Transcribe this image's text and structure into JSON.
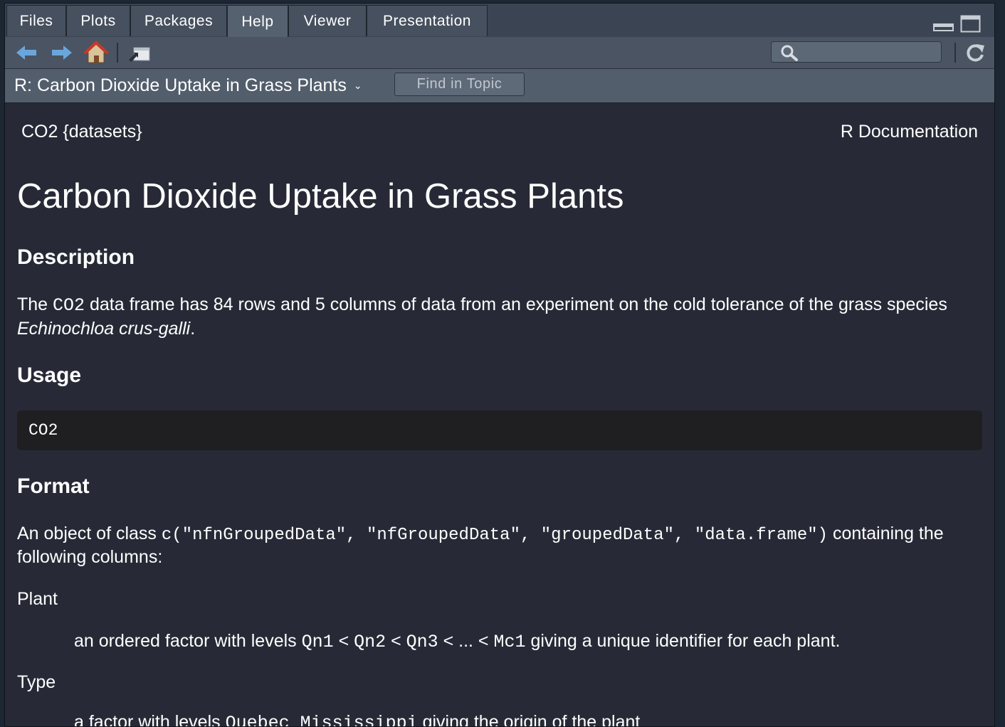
{
  "tabs": [
    {
      "label": "Files"
    },
    {
      "label": "Plots"
    },
    {
      "label": "Packages"
    },
    {
      "label": "Help"
    },
    {
      "label": "Viewer"
    },
    {
      "label": "Presentation"
    }
  ],
  "active_tab": "Help",
  "toolbar": {
    "search_value": ""
  },
  "topic": {
    "title": "R: Carbon Dioxide Uptake in Grass Plants",
    "caret": "⌄",
    "find_label": "Find in Topic"
  },
  "doc": {
    "package": "CO2 {datasets}",
    "doc_type": "R Documentation",
    "title": "Carbon Dioxide Uptake in Grass Plants",
    "description_heading": "Description",
    "description_pre": "The ",
    "description_code": "CO2",
    "description_mid": " data frame has 84 rows and 5 columns of data from an experiment on the cold tolerance of the grass species ",
    "description_species": "Echinochloa crus-galli",
    "description_post": ".",
    "usage_heading": "Usage",
    "usage_code": "CO2",
    "format_heading": "Format",
    "format_pre": "An object of class ",
    "format_code": "c(\"nfnGroupedData\", \"nfGroupedData\", \"groupedData\", \"data.frame\")",
    "format_post": " containing the following columns:",
    "plant_term": "Plant",
    "plant_pre": "an ordered factor with levels ",
    "plant_l1": "Qn1",
    "lt": " < ",
    "plant_l2": "Qn2",
    "plant_l3": "Qn3",
    "ellipsis": " < ... < ",
    "plant_l4": "Mc1",
    "plant_post": " giving a unique identifier for each plant.",
    "type_term": "Type",
    "type_pre": "a factor with levels ",
    "type_code": "Quebec Mississippi",
    "type_post": " giving the origin of the plant"
  }
}
